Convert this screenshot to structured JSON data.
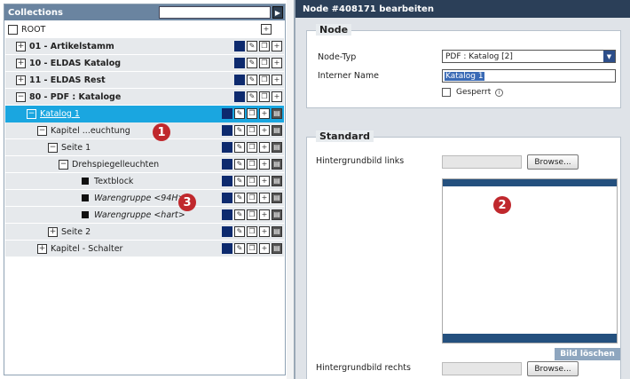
{
  "left": {
    "title": "Collections",
    "search_value": "",
    "go_label": "▶",
    "root_label": "ROOT",
    "root_plus": "+",
    "rows": [
      {
        "label": "01 - Artikelstamm",
        "toggle": "+"
      },
      {
        "label": "10 - ELDAS Katalog",
        "toggle": "+"
      },
      {
        "label": "11 - ELDAS Rest",
        "toggle": "+"
      },
      {
        "label": "80 - PDF : Kataloge",
        "toggle": "−"
      },
      {
        "label": "Katalog 1",
        "toggle": "−"
      },
      {
        "label": "Kapitel ...euchtung",
        "toggle": "−"
      },
      {
        "label": "Seite 1",
        "toggle": "−"
      },
      {
        "label": "Drehspiegelleuchten",
        "toggle": "−"
      },
      {
        "label": "Textblock"
      },
      {
        "label": "Warengruppe <94H>"
      },
      {
        "label": "Warengruppe <hart>"
      },
      {
        "label": "Seite 2",
        "toggle": "+"
      },
      {
        "label": "Kapitel - Schalter",
        "toggle": "+"
      }
    ],
    "action_glyphs": {
      "edit": "✎",
      "copy": "❐",
      "add": "+",
      "lock": "▤"
    }
  },
  "markers": {
    "m1": "1",
    "m2": "2",
    "m3": "3"
  },
  "right": {
    "title": "Node #408171 bearbeiten",
    "node_section": {
      "title": "Node",
      "type_label": "Node-Typ",
      "type_value": "PDF : Katalog [2]",
      "type_arrow": "▼",
      "name_label": "Interner Name",
      "name_value": "Katalog 1",
      "locked_label": "Gesperrt",
      "info_glyph": "i"
    },
    "standard_section": {
      "title": "Standard",
      "bg_left_label": "Hintergrundbild links",
      "bg_right_label": "Hintergrundbild rechts",
      "browse_label": "Browse...",
      "delete_label": "Bild löschen"
    }
  }
}
